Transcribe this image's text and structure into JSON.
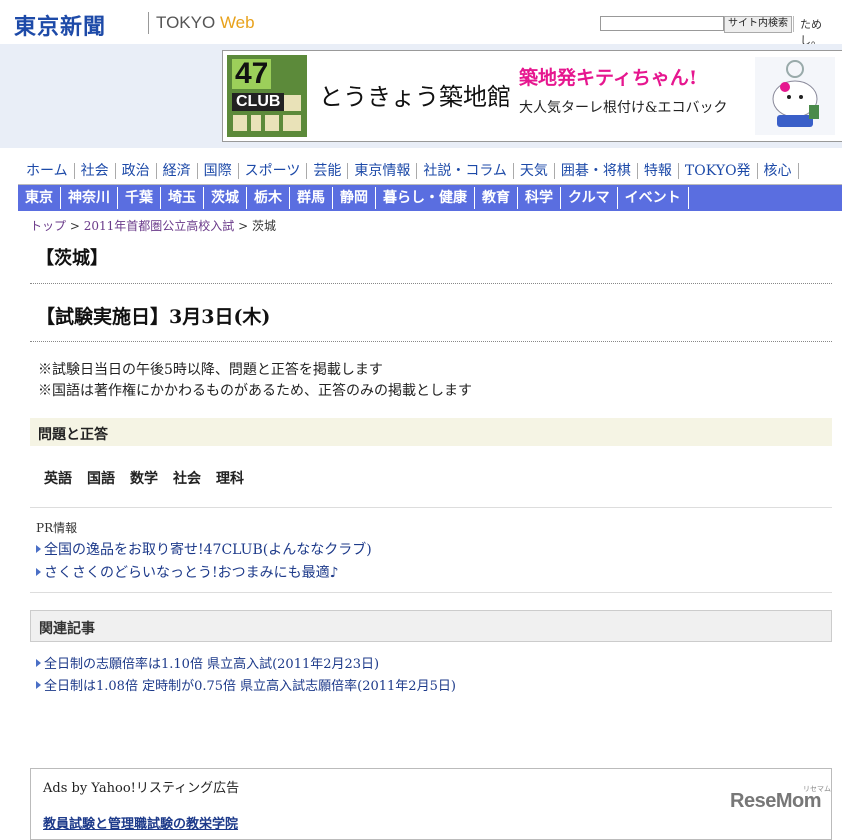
{
  "header": {
    "logo": "東京新聞",
    "logo_sub_prefix": "TOKYO ",
    "logo_sub_web": "Web",
    "search_placeholder": "",
    "search_button": "サイト内検索",
    "header_link": "ためし。"
  },
  "banner": {
    "club_number": "47",
    "club_label": "CLUB",
    "main_text": "とうきょう築地館",
    "headline": "築地発キティちゃん!",
    "sub_text": "大人気ターレ根付け&エコバック",
    "colors": {
      "headline": "#e6178f",
      "club_green": "#9ccf5a"
    }
  },
  "nav_primary": [
    "ホーム",
    "社会",
    "政治",
    "経済",
    "国際",
    "スポーツ",
    "芸能",
    "東京情報",
    "社説・コラム",
    "天気",
    "囲碁・将棋",
    "特報",
    "TOKYO発",
    "核心"
  ],
  "nav_secondary": [
    "東京",
    "神奈川",
    "千葉",
    "埼玉",
    "茨城",
    "栃木",
    "群馬",
    "静岡",
    "暮らし・健康",
    "教育",
    "科学",
    "クルマ",
    "イベント"
  ],
  "breadcrumb": {
    "top": "トップ",
    "sep1": " > ",
    "category": "2011年首都圏公立高校入試",
    "sep2": " > ",
    "current": "茨城"
  },
  "page": {
    "pref_title": "【茨城】",
    "exam_date": "【試験実施日】3月3日(木)",
    "note1": "※試験日当日の午後5時以降、問題と正答を掲載します",
    "note2": "※国語は著作権にかかわるものがあるため、正答のみの掲載とします",
    "qa_title": "問題と正答",
    "subjects": [
      "英語",
      "国語",
      "数学",
      "社会",
      "理科"
    ]
  },
  "pr": {
    "label": "PR情報",
    "links": [
      "全国の逸品をお取り寄せ!47CLUB(よんななクラブ)",
      "さくさくのどらいなっとう!おつまみにも最適♪"
    ]
  },
  "related": {
    "title": "関連記事",
    "links": [
      "全日制の志願倍率は1.10倍 県立高入試(2011年2月23日)",
      "全日制は1.08倍 定時制が0.75倍 県立高入試志願倍率(2011年2月5日)"
    ]
  },
  "ads": {
    "label": "Ads by Yahoo!リスティング広告",
    "link": "教員試験と管理職試験の教栄学院"
  },
  "watermark": {
    "text": "ReseMom",
    "small": "リセマム"
  }
}
